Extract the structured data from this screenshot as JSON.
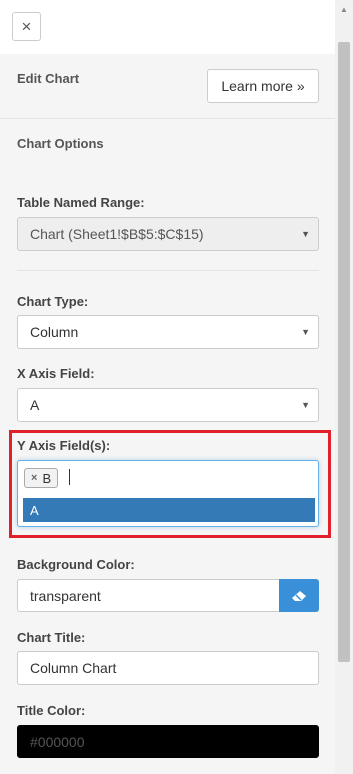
{
  "topbar": {
    "close_glyph": "×"
  },
  "header": {
    "title": "Edit Chart",
    "learn_more": "Learn more »"
  },
  "options": {
    "heading": "Chart Options",
    "table_range": {
      "label": "Table Named Range:",
      "value": "Chart (Sheet1!$B$5:$C$15)"
    },
    "chart_type": {
      "label": "Chart Type:",
      "value": "Column"
    },
    "x_axis": {
      "label": "X Axis Field:",
      "value": "A"
    },
    "y_axis": {
      "label": "Y Axis Field(s):",
      "selected_tags": [
        "B"
      ],
      "tag_remove_glyph": "×",
      "dropdown_options": [
        "A"
      ]
    },
    "background_color": {
      "label": "Background Color:",
      "value": "transparent"
    },
    "chart_title": {
      "label": "Chart Title:",
      "value": "Column Chart"
    },
    "title_color": {
      "label": "Title Color:",
      "placeholder": "#000000",
      "swatch": "#000000"
    }
  },
  "colors": {
    "accent": "#337ab7",
    "highlight": "#e2202c",
    "button": "#3a8fd9"
  },
  "icons": {
    "caret": "caret-down-icon",
    "eraser": "eraser-icon",
    "close": "close-icon"
  }
}
